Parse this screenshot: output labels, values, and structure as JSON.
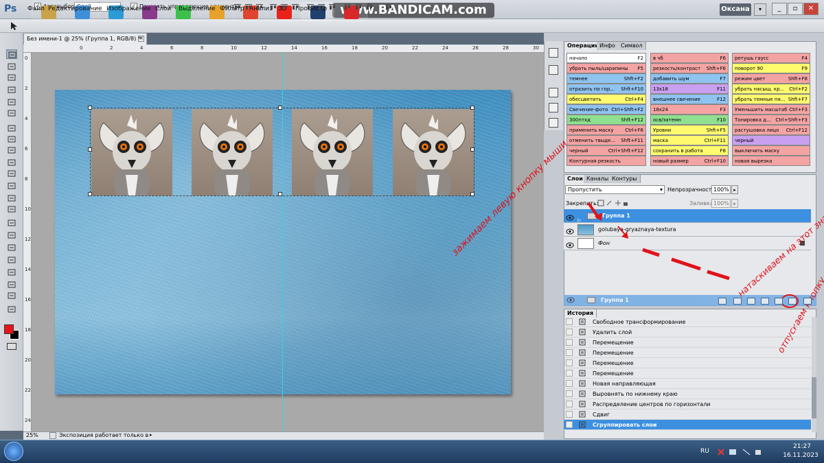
{
  "app": {
    "logo": "Ps",
    "watermark": "www.BANDICAM.com",
    "user": "Оксана"
  },
  "menu": [
    "Файл",
    "Редактирование",
    "Изображение",
    "Слои",
    "Выделение",
    "Фильтр",
    "Анализ",
    "3D",
    "Просмотр"
  ],
  "options": {
    "autoselect_label": "Автовыбор:",
    "autoselect_value": "Слой",
    "show_controls_label": "Показать управляющие элементы"
  },
  "document": {
    "tab_title": "Без имени-1 @ 25% (Группа 1, RGB/8) *",
    "zoom": "25%",
    "status": "Экспозиция работает только в ...",
    "ruler_top": [
      "0",
      "2",
      "4",
      "6",
      "8",
      "10",
      "12",
      "14",
      "16",
      "18",
      "20",
      "22",
      "24",
      "26",
      "28",
      "30"
    ],
    "ruler_left": [
      "0",
      "2",
      "4",
      "6",
      "8",
      "10",
      "12",
      "14",
      "16",
      "18",
      "20",
      "22",
      "24"
    ]
  },
  "actions_panel": {
    "tabs": [
      "Операции",
      "Инфо",
      "Символ"
    ],
    "rows": [
      [
        {
          "name": "начало",
          "key": "F2",
          "color": "#ffffff"
        },
        {
          "name": "в чб",
          "key": "F6",
          "color": "#f4a3a3"
        },
        {
          "name": "ретушь гаусс",
          "key": "F4",
          "color": "#f4a3a3"
        }
      ],
      [
        {
          "name": "убрать пыль/царапины",
          "key": "F5",
          "color": "#f4a3a3"
        },
        {
          "name": "резкость/контраст",
          "key": "Shft+F6",
          "color": "#f4a3a3"
        },
        {
          "name": "поворот 90",
          "key": "F9",
          "color": "#fffa6e"
        }
      ],
      [
        {
          "name": "темнее",
          "key": "Shft+F2",
          "color": "#8fc3f0"
        },
        {
          "name": "добавить шум",
          "key": "F7",
          "color": "#8fc3f0"
        },
        {
          "name": "режим цвет",
          "key": "Shft+F8",
          "color": "#f4a3a3"
        }
      ],
      [
        {
          "name": "отразить по гор...",
          "key": "Shft+F10",
          "color": "#8fc3f0"
        },
        {
          "name": "13x18",
          "key": "F11",
          "color": "#c9a0f0"
        },
        {
          "name": "убрать насыщ. кр...",
          "key": "Ctrl+F2",
          "color": "#fffa6e"
        }
      ],
      [
        {
          "name": "обесцветить",
          "key": "Ctrl+F4",
          "color": "#fffa6e"
        },
        {
          "name": "внешнее свечение",
          "key": "F12",
          "color": "#8fc3f0"
        },
        {
          "name": "убрать темные пя...",
          "key": "Shft+F7",
          "color": "#fffa6e"
        }
      ],
      [
        {
          "name": "Свечение-фото",
          "key": "Ctrl+Shft+F2",
          "color": "#8fc3f0"
        },
        {
          "name": "18x24",
          "key": "F3",
          "color": "#f4a3a3"
        },
        {
          "name": "Уменьшить масштаб",
          "key": "Ctrl+F3",
          "color": "#f4a3a3"
        }
      ],
      [
        {
          "name": "300птxд",
          "key": "Shft+F12",
          "color": "#8fe08f"
        },
        {
          "name": "осв/затемн",
          "key": "F10",
          "color": "#8fe08f"
        },
        {
          "name": "Тонировка д...",
          "key": "Ctrl+Shft+F3",
          "color": "#f4a3a3"
        }
      ],
      [
        {
          "name": "применить маску",
          "key": "Ctrl+F6",
          "color": "#f4a3a3"
        },
        {
          "name": "Уровни",
          "key": "Shft+F5",
          "color": "#fffa6e"
        },
        {
          "name": "растушовка лицо",
          "key": "Ctrl+F12",
          "color": "#f4a3a3"
        }
      ],
      [
        {
          "name": "отменить твыде...",
          "key": "Shft+F11",
          "color": "#f4a3a3"
        },
        {
          "name": "маска",
          "key": "Ctrl+F11",
          "color": "#fffa6e"
        },
        {
          "name": "черный",
          "key": "",
          "color": "#c9a0f0"
        }
      ],
      [
        {
          "name": "черный",
          "key": "Ctrl+Shft+F12",
          "color": "#f4a3a3"
        },
        {
          "name": "сохранить в работа",
          "key": "F8",
          "color": "#fffa6e"
        },
        {
          "name": "выключить маску",
          "key": "",
          "color": "#f4a3a3"
        }
      ],
      [
        {
          "name": "Контурная резкость",
          "key": "",
          "color": "#f4a3a3"
        },
        {
          "name": "новый размер",
          "key": "Ctrl+F10",
          "color": "#f4a3a3"
        },
        {
          "name": "новая вырезка",
          "key": "",
          "color": "#f4a3a3"
        }
      ]
    ]
  },
  "layers_panel": {
    "tabs": [
      "Слои",
      "Каналы",
      "Контуры"
    ],
    "blend_mode": "Пропустить",
    "opacity_label": "Непрозрачность:",
    "opacity_value": "100%",
    "lock_label": "Закрепить:",
    "fill_label": "Заливка:",
    "fill_value": "100%",
    "layers": [
      "Группа 1",
      "golubaya-gryaznaya-textura",
      "Фон"
    ],
    "drag_label": "Группа 1"
  },
  "history_panel": {
    "tab": "История",
    "items": [
      "Свободное трансформирование",
      "Удалить слой",
      "Перемещение",
      "Перемещение",
      "Перемещение",
      "Перемещение",
      "Новая направляющая",
      "Выровнять по нижнему краю",
      "Распределение центров по горизонтали",
      "Сдвиг",
      "Сгруппировать слои"
    ]
  },
  "annotations": {
    "hold": "зажимаем левую кнопку мыши",
    "drag": "натаскиваем на этот значок",
    "release": "отпускаем кнопку"
  },
  "taskbar": {
    "lang": "RU",
    "time": "21:27",
    "date": "16.11.2023"
  }
}
